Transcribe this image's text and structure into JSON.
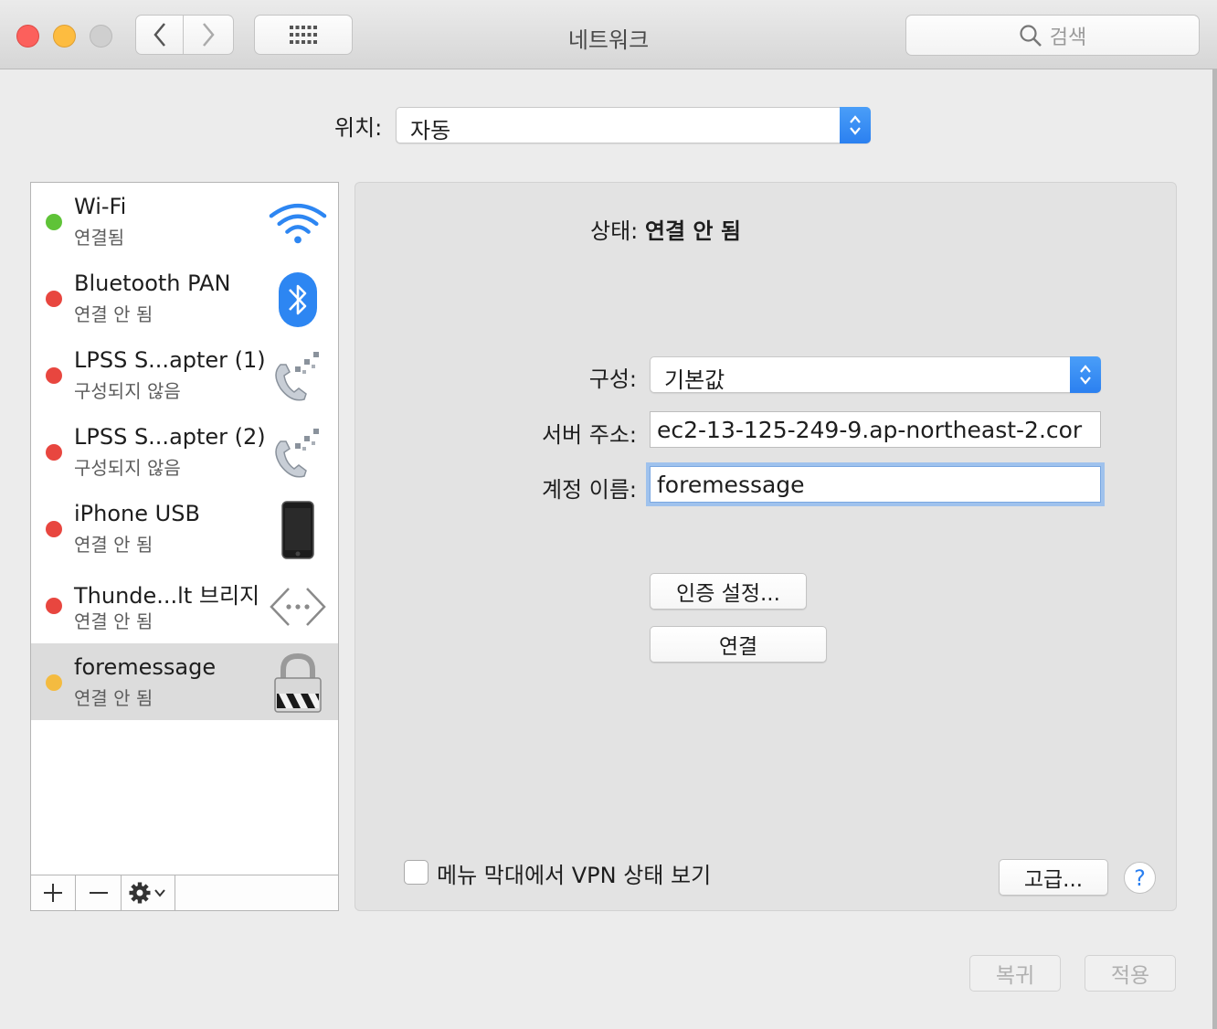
{
  "window": {
    "title": "네트워크",
    "search_placeholder": "검색"
  },
  "location": {
    "label": "위치:",
    "value": "자동"
  },
  "services": [
    {
      "name": "Wi-Fi",
      "status": "연결됨",
      "dot": "#5fc338",
      "icon": "wifi-icon",
      "selected": false
    },
    {
      "name": "Bluetooth PAN",
      "status": "연결 안 됨",
      "dot": "#e8463f",
      "icon": "bluetooth-icon",
      "selected": false
    },
    {
      "name": "LPSS S...apter (1)",
      "status": "구성되지 않음",
      "dot": "#e8463f",
      "icon": "phone-modem-icon",
      "selected": false
    },
    {
      "name": "LPSS S...apter (2)",
      "status": "구성되지 않음",
      "dot": "#e8463f",
      "icon": "phone-modem-icon",
      "selected": false
    },
    {
      "name": "iPhone USB",
      "status": "연결 안 됨",
      "dot": "#e8463f",
      "icon": "iphone-icon",
      "selected": false
    },
    {
      "name": "Thunde...lt 브리지",
      "status": "연결 안 됨",
      "dot": "#e8463f",
      "icon": "bridge-icon",
      "selected": false
    },
    {
      "name": "foremessage",
      "status": "연결 안 됨",
      "dot": "#f4bb40",
      "icon": "vpn-lock-icon",
      "selected": true
    }
  ],
  "detail": {
    "status_label": "상태:",
    "status_value": "연결 안 됨",
    "config_label": "구성:",
    "config_value": "기본값",
    "server_label": "서버 주소:",
    "server_value": "ec2-13-125-249-9.ap-northeast-2.cor",
    "account_label": "계정 이름:",
    "account_value": "foremessage",
    "auth_button": "인증 설정...",
    "connect_button": "연결",
    "show_vpn_label": "메뉴 막대에서 VPN 상태 보기",
    "advanced_button": "고급...",
    "help_button": "?"
  },
  "footer": {
    "revert_button": "복귀",
    "apply_button": "적용"
  },
  "colors": {
    "accent": "#2b80f0"
  }
}
